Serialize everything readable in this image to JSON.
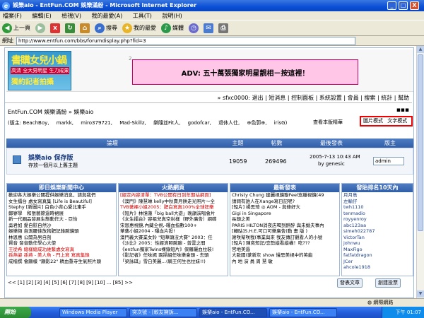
{
  "window": {
    "title": "娛樂aio - EntFun.COM 娛樂滿紛 - Microsoft Internet Explorer",
    "min": "_",
    "max": "□",
    "close": "X"
  },
  "menu": [
    "檔案(F)",
    "編輯(E)",
    "檢視(V)",
    "我的最愛(A)",
    "工具(T)",
    "說明(H)"
  ],
  "toolbar": {
    "back": "上一頁",
    "search": "搜尋",
    "favorites": "我的最愛",
    "media": "媒體"
  },
  "address": {
    "label": "網址",
    "url": "http://www.entfun.com/bbs/forumdisplay.php?fid=3"
  },
  "banner": {
    "logo_line1": "書購女兒小鍋",
    "logo_line2": "高清 全大男明星 生力成果",
    "logo_line3": "獨約記者拍攝",
    "ad_number": "2",
    "ad_text": "ADV: 五十萬張獨家明星靚相－按這裡！"
  },
  "userbar": "» sfxc0000: 退出 | 短消息 | 控制面板 | 系統設置 | 會員 | 搜索 | 統計 | 幫助",
  "breadcrumb": "EntFun.COM 娛樂滿紛 » 娛樂aio",
  "moderators": {
    "label": "(版主:",
    "names": [
      "BeachBoy,",
      "markk,",
      "miro379721,",
      "Mad-Skillz,",
      "樂隨並Fit人,",
      "godofcar,",
      "退休人仕,",
      "⊕色郭⊕,",
      "irisG)"
    ]
  },
  "mode": {
    "view_mods": "查看本版精華",
    "pic_mode": "圖片模式",
    "text_mode": "文字模式"
  },
  "forum_table": {
    "headers": [
      "論壇",
      "主題",
      "帖數",
      "最後發表",
      "版主"
    ],
    "row": {
      "name": "娛樂aio 保存版",
      "desc": "存放一個月以上舊主題",
      "topics": "19059",
      "posts": "269496",
      "last_post": "2005-7-13 10:43 AM",
      "last_by": "by genesic",
      "mod": "admin"
    }
  },
  "panels": {
    "p1": {
      "title": "即日娛樂新聞中心",
      "items": [
        "歡迎各大娛樂公關提供娛樂消息，請與我們",
        "女生擂台 處女寫真集 [Life is Beautiful]",
        "Stephy [新圖片] 白色小背心愛北東手",
        "鄭寥學　和張藝嫦過時裙展",
        "新一代圈品發展生態動作大 - 亞怡",
        "吳君如 愛自慰自然沙",
        "娛樂頻 自測腰佳放狗肥記錄腕鏡頭",
        "林恩惠 公開為男自剖",
        "賢音 發音動作學心大使",
        "王從希 總樣總成功維繫處女寫真",
        "孫燕姿 孫燕 - 美人魚 - 門上寫 寫真集錄",
        "成楷撰 會顯樣 \"顯影22\" 精血重寺生氣照片頭"
      ]
    },
    "p2": {
      "title": "火熱網頁",
      "items": [
        "[經定內容清單：TVB公開有日到年期站網頁]",
        "《澳門》陳慧琳 kelly中秋賣月餅走光照片～全",
        "TVB著裸小姐2005：肥白寫真100%全球狂樂",
        "《短片》林憶蓮「big ball大遊」晚韻演唱會片",
        "《女生擂台》容祖兒真空封樣（野外廣告）網碟",
        "宋恩惠視鏡,內藏全視,-曝血指數100+",
        "華藝小姐2004 - 曝血片投!",
        "澳門義大賽業女鈴 \"短華頭沒大賽\" 2003：任",
        "《沙比》2005：性經濟照腕腑 - 普雲之間",
        "《entfun獨家Twins裸錄短片》保羅曬血拉裝!",
        "《影記者》任咏嫣 兩掃組任咏樂會頭 - 去頭",
        "「梁詠琪」雪白美麗…(騎王何生也拉妹!!)"
      ]
    },
    "p3": {
      "title": "最新發表",
      "items": [
        "Christy Chung 建麗視鏡聯Feel支離視鏡(49",
        "請問有誰人在Xange寫日記呢?",
        "[短片] 楊思琦 ◎ AOM - 與條好大",
        "Gigi in Singapore",
        "長頭之美",
        "PARIS HILTON消夜店喝到醉醉 與未婚夫事內",
        "[轉貼]S.H.E.可口可樂廣告(動 畫 版 )",
        "謝咲幫咲我(事業與來 我友傳訂觀看人的小號",
        "[短片] 陳奕知記/恋勢縱看縱橫！吃???",
        "宮地美過",
        "大歐國(蒙新灰 show 慢思美視中的笑能",
        "內 地 演 員 周 慧 敏"
      ]
    },
    "p4": {
      "title": "發貼排名10天內",
      "rows": [
        {
          "name": "月月島",
          "val": "172"
        },
        {
          "name": "左輸仔",
          "val": "123"
        },
        {
          "name": "twh1110",
          "val": "110"
        },
        {
          "name": "tenmadio",
          "val": "101"
        },
        {
          "name": "royyenroy",
          "val": "92"
        },
        {
          "name": "abc123aa",
          "val": "90"
        },
        {
          "name": "simeh022787",
          "val": "85"
        },
        {
          "name": "VictorTan",
          "val": "79"
        },
        {
          "name": "johnwu",
          "val": "64"
        },
        {
          "name": "MaxFigo",
          "val": "60"
        },
        {
          "name": "fatfatdragon",
          "val": "59"
        },
        {
          "name": "JCer",
          "val": "50"
        },
        {
          "name": "ahcole1918",
          "val": "48"
        }
      ]
    }
  },
  "pager": "<< [1] [2] [3] [4] [5] [6] [7] [8] [9] [10] ... [85] >>",
  "buttons": {
    "post": "發表文章",
    "new": "創建投票"
  },
  "status": {
    "left": "",
    "zone": "網際網路"
  },
  "taskbar": {
    "start": "開始",
    "tasks": [
      "Windows Media Player",
      "突次號 - [較友擁訴...",
      "娛樂aio - EntFun.CO...",
      "娛樂aio - EntFun.CO..."
    ],
    "clock": "下午 01:07"
  }
}
